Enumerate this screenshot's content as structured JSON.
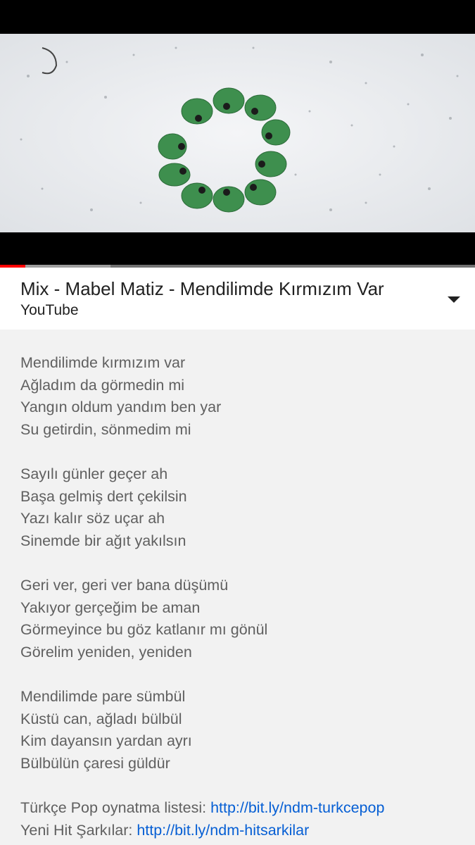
{
  "player": {
    "progress_played_fraction": 0.053,
    "progress_buffered_fraction": 0.233
  },
  "header": {
    "title": "Mix - Mabel Matiz - Mendilimde Kırmızım Var",
    "channel": "YouTube",
    "expand_icon": "chevron-down-icon"
  },
  "description": {
    "stanzas": [
      {
        "lines": [
          "Mendilimde kırmızım var",
          "Ağladım da görmedin mi",
          "Yangın oldum yandım ben yar",
          "Su getirdin, sönmedim mi"
        ]
      },
      {
        "lines": [
          "Sayılı günler geçer ah",
          "Başa gelmiş dert çekilsin",
          "Yazı kalır söz uçar ah",
          "Sinemde bir ağıt yakılsın"
        ]
      },
      {
        "lines": [
          "Geri ver, geri ver bana düşümü",
          "Yakıyor gerçeğim be aman",
          "Görmeyince bu göz katlanır mı gönül",
          "Görelim yeniden, yeniden"
        ]
      },
      {
        "lines": [
          "Mendilimde pare sümbül",
          "Küstü can, ağladı bülbül",
          "Kim dayansın yardan ayrı",
          "Bülbülün çaresi güldür"
        ]
      }
    ],
    "links": [
      {
        "label": "Türkçe Pop oynatma listesi: ",
        "url": "http://bit.ly/ndm-turkcepop"
      },
      {
        "label": "Yeni Hit Şarkılar: ",
        "url": "http://bit.ly/ndm-hitsarkilar"
      }
    ]
  },
  "colors": {
    "progress_played": "#ff0000",
    "link": "#065fd4",
    "background": "#f2f2f2"
  }
}
